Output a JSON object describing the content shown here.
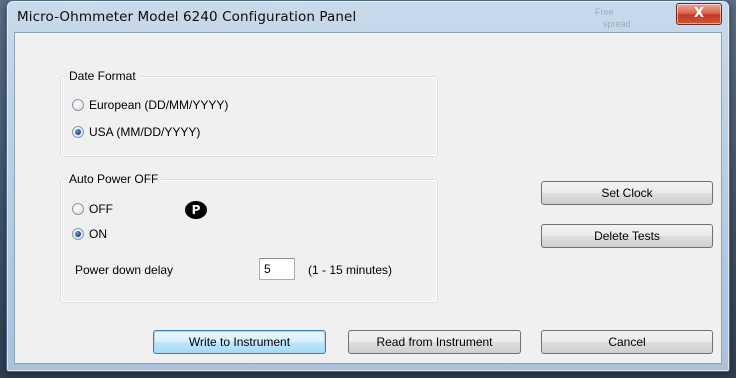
{
  "window": {
    "title": "Micro-Ohmmeter Model 6240 Configuration Panel",
    "close_glyph": "X",
    "ghost_1": "Free",
    "ghost_2": "spread"
  },
  "date_format": {
    "legend": "Date Format",
    "options": [
      {
        "label": "European (DD/MM/YYYY)",
        "checked": false
      },
      {
        "label": "USA (MM/DD/YYYY)",
        "checked": true
      }
    ]
  },
  "auto_power": {
    "legend": "Auto Power OFF",
    "options": [
      {
        "label": "OFF",
        "checked": false
      },
      {
        "label": "ON",
        "checked": true
      }
    ],
    "p_icon": "P",
    "delay_label": "Power down delay",
    "delay_value": "5",
    "delay_range": "(1 - 15 minutes)"
  },
  "side_buttons": {
    "set_clock": "Set Clock",
    "delete_tests": "Delete Tests"
  },
  "bottom_buttons": {
    "write": "Write to Instrument",
    "read": "Read from Instrument",
    "cancel": "Cancel"
  }
}
